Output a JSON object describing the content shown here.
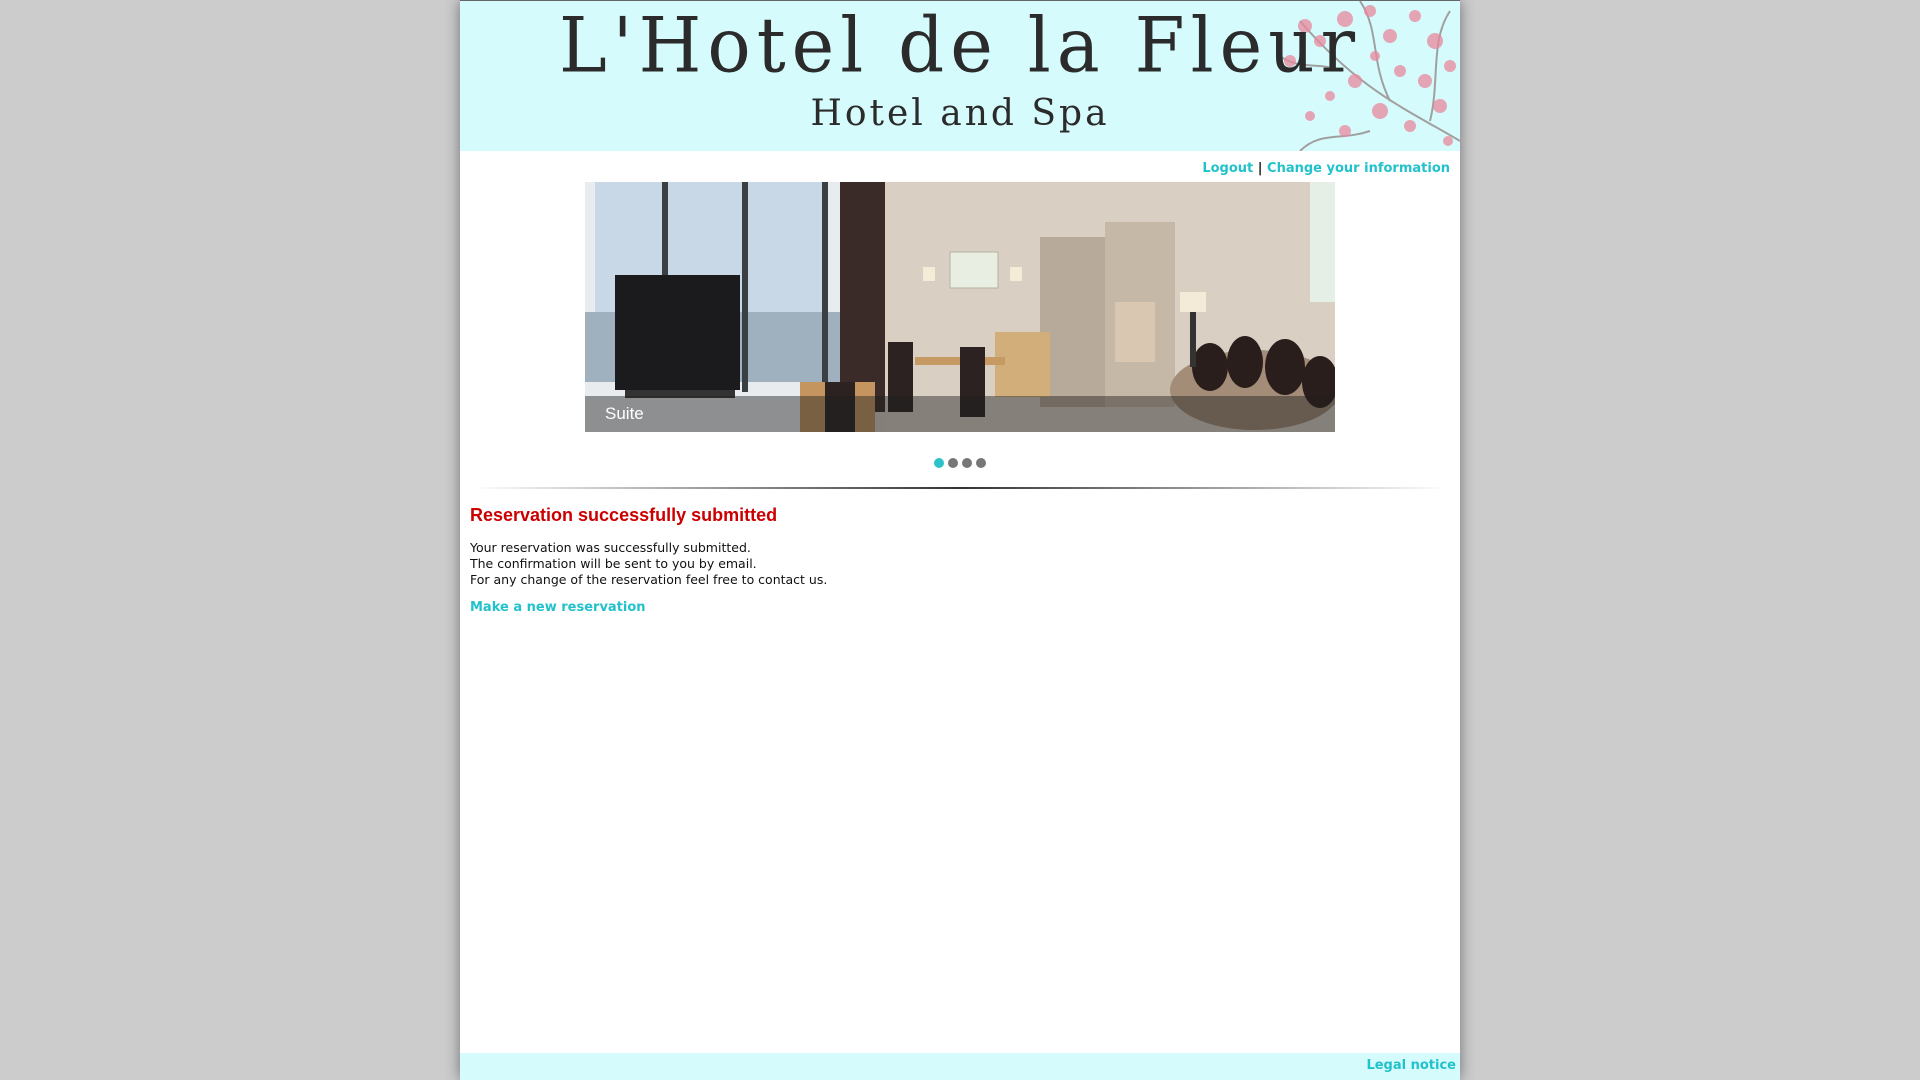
{
  "header": {
    "title": "L'Hotel de la Fleur",
    "subtitle": "Hotel and Spa"
  },
  "top_links": {
    "logout": "Logout",
    "separator": "|",
    "change_info": "Change your information"
  },
  "slider": {
    "caption": "Suite",
    "dots_total": 4,
    "active_dot": 1
  },
  "confirmation": {
    "heading": "Reservation successfully submitted",
    "line1": "Your reservation was successfully submitted.",
    "line2": "The confirmation will be sent to you by email.",
    "line3": "For any change of the reservation feel free to contact us.",
    "new_reservation_link": "Make a new reservation"
  },
  "footer": {
    "legal_notice": "Legal notice"
  },
  "colors": {
    "link": "#22c2cc",
    "heading": "#cc0000",
    "header_bg": "#d6fbfc",
    "page_bg": "#cccccc",
    "active_dot": "#2ec3c9"
  }
}
